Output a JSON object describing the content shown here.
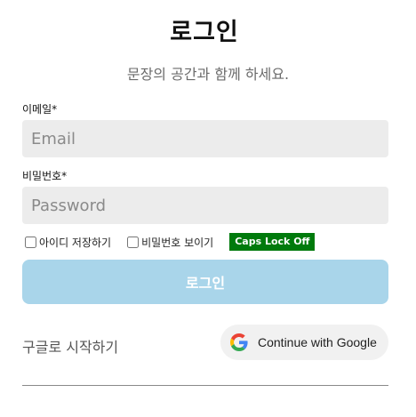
{
  "title": "로그인",
  "subtitle": "문장의 공간과 함께 하세요.",
  "email": {
    "label": "이메일*",
    "placeholder": "Email"
  },
  "password": {
    "label": "비밀번호*",
    "placeholder": "Password"
  },
  "options": {
    "save_id": "아이디 저장하기",
    "show_password": "비밀번호 보이기",
    "caps_lock": "Caps Lock Off",
    "caps_lock_color": "#007a0c"
  },
  "login_button": "로그인",
  "google": {
    "prompt": "구글로 시작하기",
    "button": "Continue with Google"
  }
}
